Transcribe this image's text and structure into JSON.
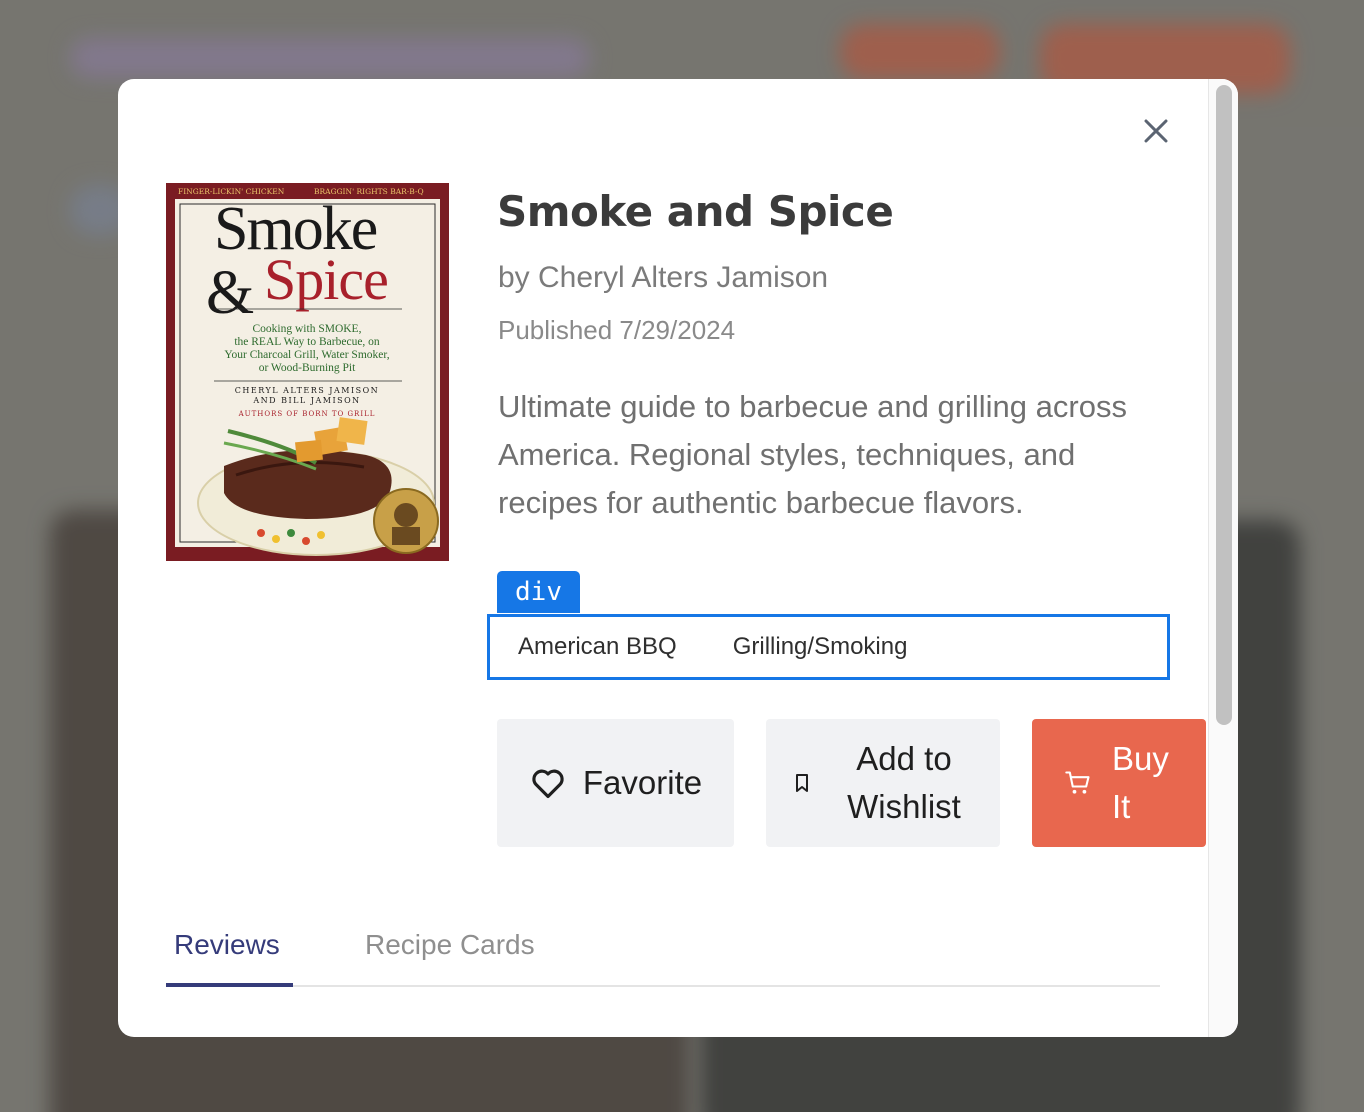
{
  "book": {
    "title": "Smoke and Spice",
    "author_line": "by Cheryl Alters Jamison",
    "published_line": "Published 7/29/2024",
    "description": "Ultimate guide to barbecue and grilling across America. Regional styles, techniques, and recipes for authentic barbecue flavors.",
    "tags": [
      "American BBQ",
      "Grilling/Smoking"
    ]
  },
  "cover": {
    "top_left": "FINGER-LICKIN' CHICKEN",
    "top_right": "BRAGGIN' RIGHTS BAR-B-Q",
    "word1": "Smoke",
    "amp": "&",
    "word2": "Spice",
    "subtitle_1": "Cooking with SMOKE,",
    "subtitle_2": "the REAL Way to Barbecue, on",
    "subtitle_3": "Your Charcoal Grill, Water Smoker,",
    "subtitle_4": "or Wood-Burning Pit",
    "authors_1": "CHERYL ALTERS JAMISON",
    "authors_2": "AND BILL JAMISON",
    "authors_3": "AUTHORS OF BORN TO GRILL"
  },
  "inspector": {
    "tag_label": "div"
  },
  "actions": {
    "favorite_label": "Favorite",
    "wishlist_label": "Add to Wishlist",
    "buy_label": "Buy It"
  },
  "tabs": [
    {
      "label": "Reviews",
      "active": true
    },
    {
      "label": "Recipe Cards",
      "active": false
    }
  ],
  "icons": {
    "close": "close-icon",
    "favorite": "heart-icon",
    "wishlist": "bookmark-icon",
    "buy": "cart-icon"
  },
  "colors": {
    "buy_button": "#e8674e",
    "active_tab": "#353b7a",
    "inspector_highlight": "#1677e6"
  }
}
